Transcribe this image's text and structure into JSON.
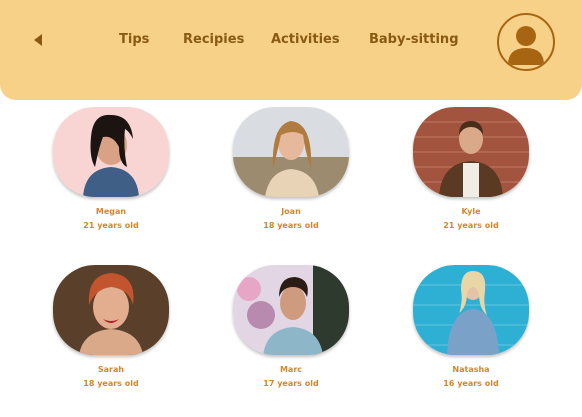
{
  "header": {
    "back_icon": "back-arrow-icon",
    "nav": {
      "tips": "Tips",
      "recipes": "Recipies",
      "activities": "Activities",
      "babysitting": "Baby-sitting"
    },
    "avatar_icon": "user-avatar-icon",
    "colors": {
      "bar": "#f7d188",
      "text": "#8a5a12",
      "avatar": "#a86511"
    }
  },
  "sitters": [
    {
      "name": "Megan",
      "age": "21 years old"
    },
    {
      "name": "Joan",
      "age": "18 years old"
    },
    {
      "name": "Kyle",
      "age": "21 years old"
    },
    {
      "name": "Sarah",
      "age": "18 years old"
    },
    {
      "name": "Marc",
      "age": "17 years old"
    },
    {
      "name": "Natasha",
      "age": "16 years old"
    }
  ],
  "accent_text_color": "#d4872a"
}
